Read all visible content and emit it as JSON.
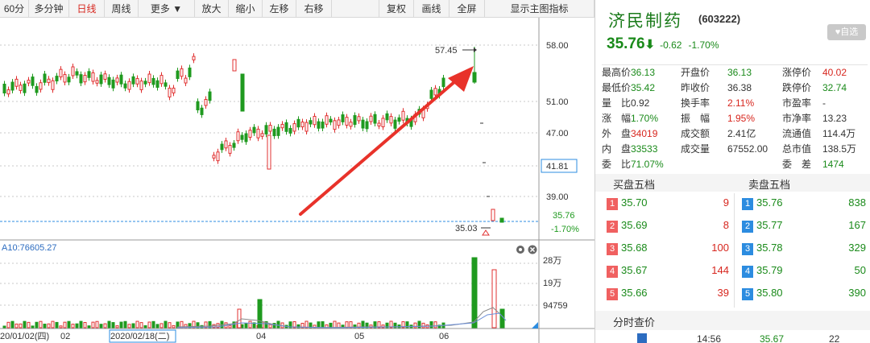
{
  "toolbar": {
    "items": [
      "60分",
      "多分钟",
      "日线",
      "周线",
      "更多 ▼",
      "放大",
      "缩小",
      "左移",
      "右移",
      "复权",
      "画线",
      "全屏",
      "显示主图指标"
    ],
    "active_index": 2
  },
  "chart": {
    "price_axis_labels": [
      "58.00",
      "51.00",
      "47.00",
      "41.81",
      "39.00",
      "35.76",
      "-1.70%"
    ],
    "max_marker": "57.45",
    "min_marker": "35.03",
    "ma_label": "A10:76605.27",
    "volume_axis_labels": [
      "28万",
      "19万",
      "94759"
    ],
    "date_labels": [
      "20/01/02(四)",
      "02",
      "2020/02/18(二)",
      "04",
      "05",
      "06"
    ],
    "colors": {
      "up": "#e03030",
      "down": "#1f9a1f",
      "arrow": "#e8322a",
      "axis": "#555555",
      "grid": "#c8c8c8"
    }
  },
  "quote": {
    "name": "济民制药",
    "code": "(603222)",
    "fav": "♥自选",
    "price": "35.76",
    "arrow": "⬇",
    "change": "-0.62",
    "change_pct": "-1.70%",
    "rows": [
      [
        [
          "最高价",
          "36.13",
          "g"
        ],
        [
          "开盘价",
          "36.13",
          "g"
        ],
        [
          "涨停价",
          "40.02",
          "r"
        ]
      ],
      [
        [
          "最低价",
          "35.42",
          "g"
        ],
        [
          "昨收价",
          "36.38",
          "b"
        ],
        [
          "跌停价",
          "32.74",
          "g"
        ]
      ],
      [
        [
          "量　比",
          "0.92",
          "b"
        ],
        [
          "换手率",
          "2.11%",
          "r"
        ],
        [
          "市盈率",
          "-",
          "b"
        ]
      ],
      [
        [
          "涨　幅",
          "1.70%",
          "g"
        ],
        [
          "振　幅",
          "1.95%",
          "r"
        ],
        [
          "市净率",
          "13.23",
          "b"
        ]
      ],
      [
        [
          "外　盘",
          "34019",
          "r"
        ],
        [
          "成交额",
          "2.41亿",
          "b"
        ],
        [
          "流通值",
          "114.4万",
          "b"
        ]
      ],
      [
        [
          "内　盘",
          "33533",
          "g"
        ],
        [
          "成交量",
          "67552.00",
          "b"
        ],
        [
          "总市值",
          "138.5万",
          "b"
        ]
      ],
      [
        [
          "委　比",
          "71.07%",
          "g"
        ],
        [
          "",
          "",
          "b"
        ],
        [
          "委　差",
          "1474",
          "g"
        ]
      ]
    ]
  },
  "book": {
    "buy_title": "买盘五档",
    "sell_title": "卖盘五档",
    "buy": [
      {
        "n": "1",
        "p": "35.70",
        "v": "9"
      },
      {
        "n": "2",
        "p": "35.69",
        "v": "8"
      },
      {
        "n": "3",
        "p": "35.68",
        "v": "100"
      },
      {
        "n": "4",
        "p": "35.67",
        "v": "144"
      },
      {
        "n": "5",
        "p": "35.66",
        "v": "39"
      }
    ],
    "sell": [
      {
        "n": "1",
        "p": "35.76",
        "v": "838"
      },
      {
        "n": "2",
        "p": "35.77",
        "v": "167"
      },
      {
        "n": "3",
        "p": "35.78",
        "v": "329"
      },
      {
        "n": "4",
        "p": "35.79",
        "v": "50"
      },
      {
        "n": "5",
        "p": "35.80",
        "v": "390"
      }
    ]
  },
  "ticks": {
    "title": "分时查价",
    "row": {
      "time": "14:56",
      "price": "35.67",
      "vol": "22"
    }
  }
}
